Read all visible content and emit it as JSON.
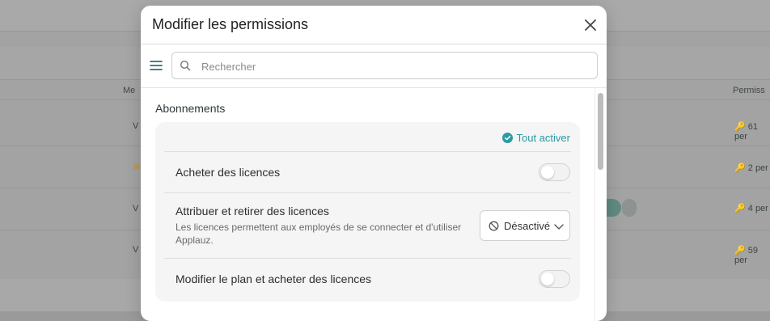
{
  "background": {
    "col_left": "Me",
    "col_right": "Permiss",
    "rows": [
      {
        "left": "V",
        "right": "61 per"
      },
      {
        "left": "",
        "right": "2 per"
      },
      {
        "left": "V",
        "right": "4 per"
      },
      {
        "left": "V",
        "right": "59 per"
      }
    ]
  },
  "modal": {
    "title": "Modifier les permissions",
    "close_icon": "close-icon",
    "menu_icon": "menu-icon",
    "search": {
      "placeholder": "Rechercher",
      "value": ""
    },
    "section": {
      "title": "Abonnements",
      "enable_all_label": "Tout activer",
      "accent_color": "#2a9aa3",
      "items": [
        {
          "label": "Acheter des licences",
          "control": "toggle",
          "enabled": false
        },
        {
          "label": "Attribuer et retirer des licences",
          "description": "Les licences permettent aux employés de se connecter et d'utiliser Applauz.",
          "control": "select",
          "value": "Désactivé"
        },
        {
          "label": "Modifier le plan et acheter des licences",
          "control": "toggle",
          "enabled": false
        }
      ]
    }
  }
}
